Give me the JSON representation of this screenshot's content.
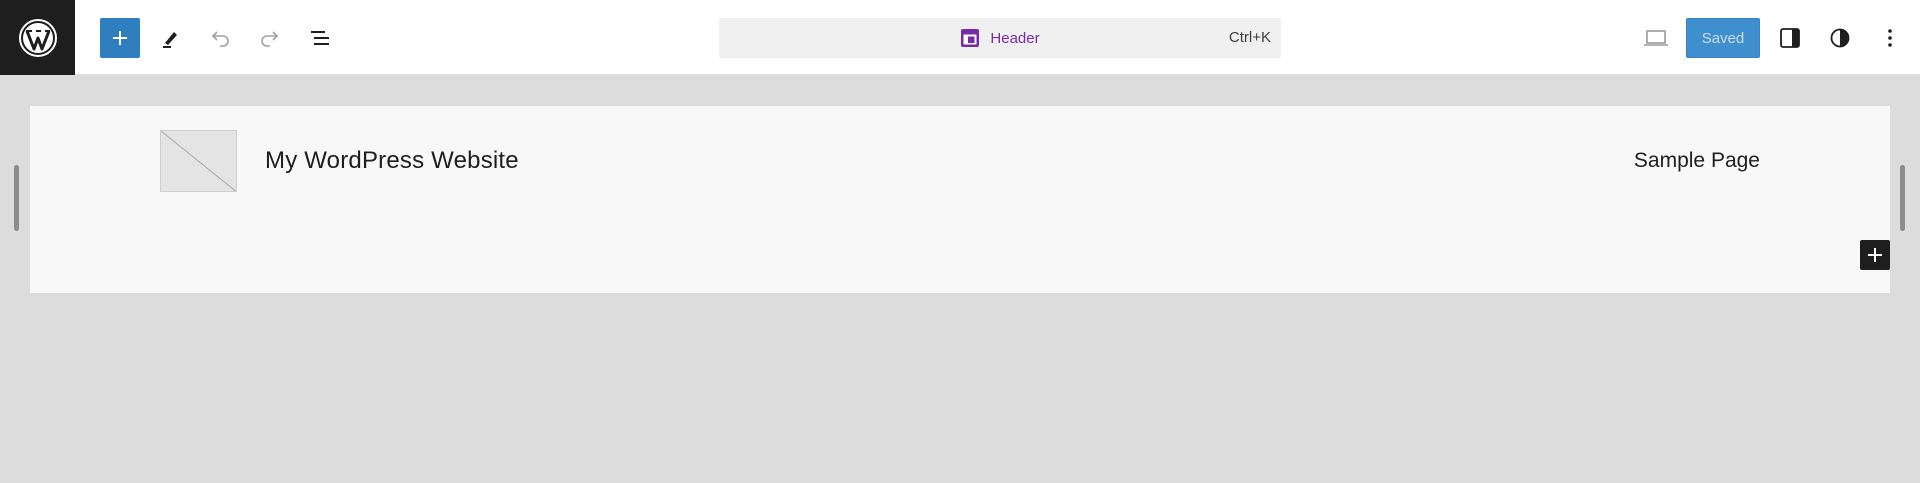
{
  "toolbar": {
    "logo_icon": "wordpress-logo-icon",
    "add_icon": "plus-icon",
    "tools_icon": "pencil-icon",
    "undo_icon": "undo-icon",
    "redo_icon": "redo-icon",
    "listview_icon": "list-view-icon"
  },
  "command_bar": {
    "icon": "template-part-icon",
    "title": "Header",
    "shortcut": "Ctrl+K"
  },
  "actions": {
    "device_icon": "desktop-preview-icon",
    "saved_label": "Saved",
    "settings_icon": "sidebar-toggle-icon",
    "styles_icon": "half-circle-contrast-icon",
    "options_icon": "vertical-ellipsis-icon"
  },
  "canvas": {
    "site_title": "My WordPress Website",
    "nav_link": "Sample Page",
    "inserter_icon": "plus-icon"
  },
  "colors": {
    "accent": "#2f7fbf",
    "command_title": "#7a2aa8",
    "canvas_bg": "#f8f8f8",
    "editor_bg": "#dcdcdc",
    "dark": "#1e1e1e"
  }
}
